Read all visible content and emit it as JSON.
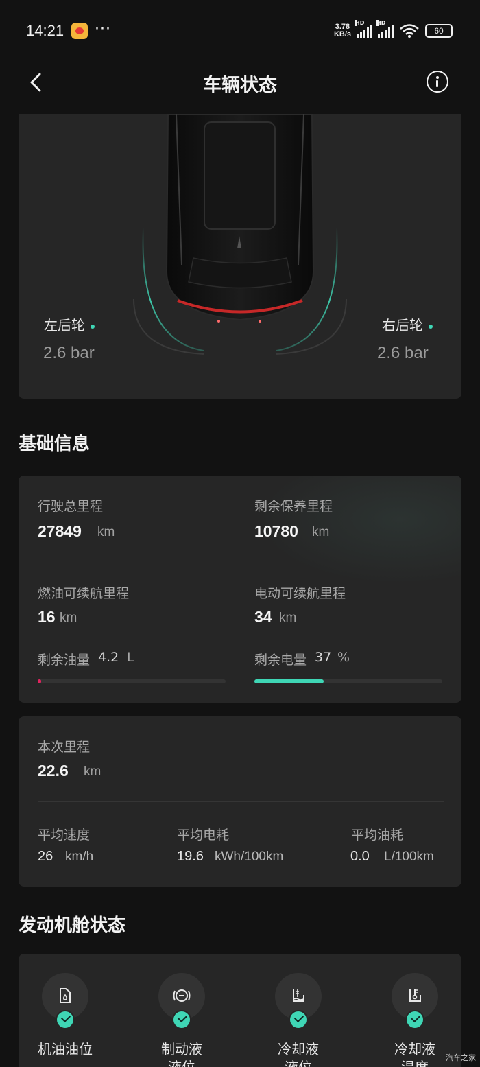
{
  "status_bar": {
    "time": "14:21",
    "speed_value": "3.78",
    "speed_unit": "KB/s",
    "sig_badge": "HD",
    "battery": "60",
    "icons": [
      "weibo-app-icon",
      "more-dots-icon",
      "signal-icon",
      "wifi-icon",
      "battery-icon"
    ]
  },
  "header": {
    "title": "车辆状态",
    "back_icon": "chevron-left-icon",
    "info_icon": "info-icon"
  },
  "tires": {
    "rear_left_label": "左后轮",
    "rear_left_value": "2.6 bar",
    "rear_right_label": "右后轮",
    "rear_right_value": "2.6 bar",
    "status_color": "#3fd6b5"
  },
  "basic_info": {
    "section_title": "基础信息",
    "total_mileage_label": "行驶总里程",
    "total_mileage_value": "27849",
    "total_mileage_unit": "km",
    "maintenance_label": "剩余保养里程",
    "maintenance_value": "10780",
    "maintenance_unit": "km",
    "fuel_range_label": "燃油可续航里程",
    "fuel_range_value": "16",
    "fuel_range_unit": "km",
    "ev_range_label": "电动可续航里程",
    "ev_range_value": "34",
    "ev_range_unit": "km",
    "fuel_left_label": "剩余油量",
    "fuel_left_value": "4.2",
    "fuel_left_unit": "L",
    "fuel_level_fraction": 0.02,
    "fuel_bar_color": "#e0245e",
    "battery_left_label": "剩余电量",
    "battery_left_value": "37",
    "battery_left_unit": "%",
    "battery_level_fraction": 0.37,
    "battery_bar_color": "#3fd6b5"
  },
  "trip": {
    "trip_label": "本次里程",
    "trip_value": "22.6",
    "trip_unit": "km",
    "avg_speed_label": "平均速度",
    "avg_speed_value": "26",
    "avg_speed_unit": "km/h",
    "avg_power_label": "平均电耗",
    "avg_power_value": "19.6",
    "avg_power_unit": "kWh/100km",
    "avg_fuel_label": "平均油耗",
    "avg_fuel_value": "0.0",
    "avg_fuel_unit": "L/100km"
  },
  "engine": {
    "section_title": "发动机舱状态",
    "items": [
      {
        "label": "机油油位",
        "icon": "oil-level-icon",
        "status": "ok"
      },
      {
        "label": "制动液\n液位",
        "icon": "brake-fluid-icon",
        "status": "ok"
      },
      {
        "label": "冷却液\n液位",
        "icon": "coolant-level-icon",
        "status": "ok"
      },
      {
        "label": "冷却液\n温度",
        "icon": "coolant-temp-icon",
        "status": "ok"
      }
    ]
  },
  "watermark": "汽车之家"
}
